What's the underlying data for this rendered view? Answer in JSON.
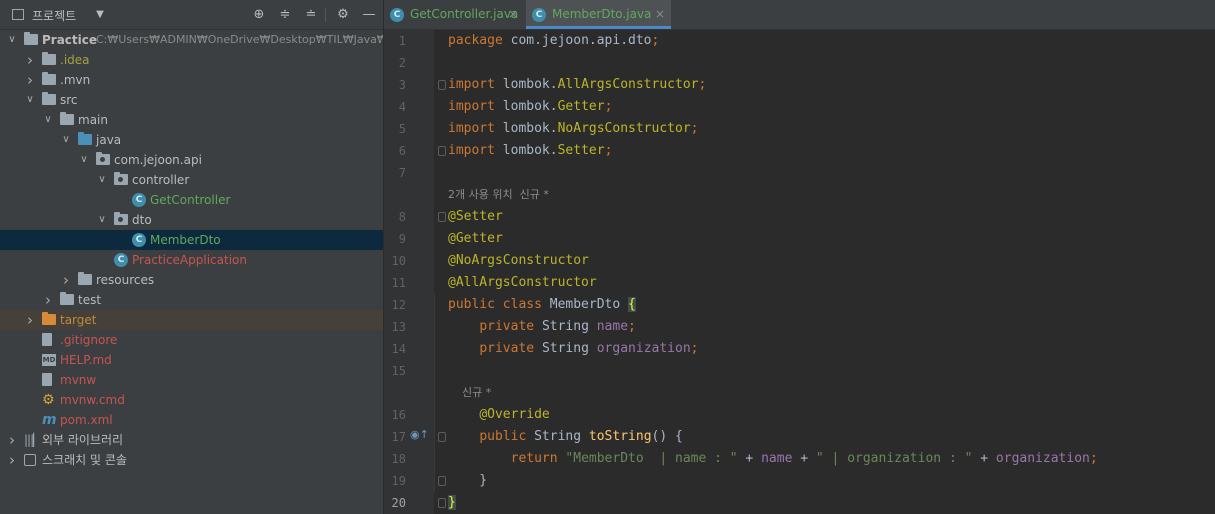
{
  "project_panel": {
    "title": "프로젝트",
    "tree": [
      {
        "label": "Practice",
        "hint": "C:₩Users₩ADMIN₩OneDrive₩Desktop₩TIL₩Java₩스프",
        "depth": 0,
        "arrow": "open",
        "icon": "module",
        "color": "white",
        "bold": true
      },
      {
        "label": ".idea",
        "depth": 1,
        "arrow": "closed",
        "icon": "folder",
        "color": "yellow"
      },
      {
        "label": ".mvn",
        "depth": 1,
        "arrow": "closed",
        "icon": "folder",
        "color": "white"
      },
      {
        "label": "src",
        "depth": 1,
        "arrow": "open",
        "icon": "folder",
        "color": "white"
      },
      {
        "label": "main",
        "depth": 2,
        "arrow": "open",
        "icon": "folder",
        "color": "white"
      },
      {
        "label": "java",
        "depth": 3,
        "arrow": "open",
        "icon": "folder-blue",
        "color": "white"
      },
      {
        "label": "com.jejoon.api",
        "depth": 4,
        "arrow": "open",
        "icon": "package",
        "color": "white"
      },
      {
        "label": "controller",
        "depth": 5,
        "arrow": "open",
        "icon": "package",
        "color": "white"
      },
      {
        "label": "GetController",
        "depth": 6,
        "arrow": "none",
        "icon": "class",
        "color": "green"
      },
      {
        "label": "dto",
        "depth": 5,
        "arrow": "open",
        "icon": "package",
        "color": "white"
      },
      {
        "label": "MemberDto",
        "depth": 6,
        "arrow": "none",
        "icon": "class",
        "color": "green",
        "selected": true
      },
      {
        "label": "PracticeApplication",
        "depth": 5,
        "arrow": "none",
        "icon": "class-app",
        "color": "red"
      },
      {
        "label": "resources",
        "depth": 3,
        "arrow": "closed",
        "icon": "folder-res",
        "color": "white"
      },
      {
        "label": "test",
        "depth": 2,
        "arrow": "closed",
        "icon": "folder",
        "color": "white"
      },
      {
        "label": "target",
        "depth": 1,
        "arrow": "closed",
        "icon": "folder-orange",
        "color": "orange",
        "highlight": true
      },
      {
        "label": ".gitignore",
        "depth": 1,
        "arrow": "none",
        "icon": "file",
        "color": "red"
      },
      {
        "label": "HELP.md",
        "depth": 1,
        "arrow": "none",
        "icon": "md",
        "color": "red"
      },
      {
        "label": "mvnw",
        "depth": 1,
        "arrow": "none",
        "icon": "file-exec",
        "color": "red"
      },
      {
        "label": "mvnw.cmd",
        "depth": 1,
        "arrow": "none",
        "icon": "cmd",
        "color": "red"
      },
      {
        "label": "pom.xml",
        "depth": 1,
        "arrow": "none",
        "icon": "maven",
        "color": "red"
      },
      {
        "label": "외부 라이브러리",
        "depth": 0,
        "arrow": "closed",
        "icon": "libraries",
        "color": "white"
      },
      {
        "label": "스크래치 및 콘솔",
        "depth": 0,
        "arrow": "closed",
        "icon": "scratches",
        "color": "white"
      }
    ]
  },
  "tabs": [
    {
      "label": "GetController.java",
      "active": false
    },
    {
      "label": "MemberDto.java",
      "active": true
    }
  ],
  "editor": {
    "current_line": 20,
    "lines": [
      {
        "n": "1",
        "tokens": [
          [
            "kw",
            "package "
          ],
          [
            "cls",
            "com.jejoon.api.dto"
          ],
          [
            "kw",
            ";"
          ]
        ]
      },
      {
        "n": "2",
        "tokens": []
      },
      {
        "n": "3",
        "tokens": [
          [
            "kw",
            "import "
          ],
          [
            "cls",
            "lombok."
          ],
          [
            "ann",
            "AllArgsConstructor"
          ],
          [
            "kw",
            ";"
          ]
        ]
      },
      {
        "n": "4",
        "tokens": [
          [
            "kw",
            "import "
          ],
          [
            "cls",
            "lombok."
          ],
          [
            "ann",
            "Getter"
          ],
          [
            "kw",
            ";"
          ]
        ]
      },
      {
        "n": "5",
        "tokens": [
          [
            "kw",
            "import "
          ],
          [
            "cls",
            "lombok."
          ],
          [
            "ann",
            "NoArgsConstructor"
          ],
          [
            "kw",
            ";"
          ]
        ]
      },
      {
        "n": "6",
        "tokens": [
          [
            "kw",
            "import "
          ],
          [
            "cls",
            "lombok."
          ],
          [
            "ann",
            "Setter"
          ],
          [
            "kw",
            ";"
          ]
        ]
      },
      {
        "n": "7",
        "tokens": []
      },
      {
        "n": "",
        "hint": "2개 사용 위치  신규 *"
      },
      {
        "n": "8",
        "tokens": [
          [
            "ann",
            "@Setter"
          ]
        ]
      },
      {
        "n": "9",
        "tokens": [
          [
            "ann",
            "@Getter"
          ]
        ]
      },
      {
        "n": "10",
        "tokens": [
          [
            "ann",
            "@NoArgsConstructor"
          ]
        ]
      },
      {
        "n": "11",
        "tokens": [
          [
            "ann",
            "@AllArgsConstructor"
          ]
        ]
      },
      {
        "n": "12",
        "tokens": [
          [
            "kw",
            "public class "
          ],
          [
            "cls",
            "MemberDto "
          ],
          [
            "brace",
            "{"
          ]
        ]
      },
      {
        "n": "13",
        "tokens": [
          [
            "cls",
            "    "
          ],
          [
            "kw",
            "private "
          ],
          [
            "cls",
            "String "
          ],
          [
            "fld",
            "name"
          ],
          [
            "kw",
            ";"
          ]
        ]
      },
      {
        "n": "14",
        "tokens": [
          [
            "cls",
            "    "
          ],
          [
            "kw",
            "private "
          ],
          [
            "cls",
            "String "
          ],
          [
            "fld",
            "organization"
          ],
          [
            "kw",
            ";"
          ]
        ]
      },
      {
        "n": "15",
        "tokens": []
      },
      {
        "n": "",
        "hint": "    신규 *"
      },
      {
        "n": "16",
        "tokens": [
          [
            "cls",
            "    "
          ],
          [
            "ann",
            "@Override"
          ]
        ]
      },
      {
        "n": "17",
        "tokens": [
          [
            "cls",
            "    "
          ],
          [
            "kw",
            "public "
          ],
          [
            "cls",
            "String "
          ],
          [
            "meth",
            "toString"
          ],
          [
            "cls",
            "() {"
          ]
        ],
        "override": true
      },
      {
        "n": "18",
        "tokens": [
          [
            "cls",
            "        "
          ],
          [
            "kw",
            "return "
          ],
          [
            "str",
            "\"MemberDto  | name : \""
          ],
          [
            "cls",
            " + "
          ],
          [
            "fld",
            "name"
          ],
          [
            "cls",
            " + "
          ],
          [
            "str",
            "\" | organization : \""
          ],
          [
            "cls",
            " + "
          ],
          [
            "fld",
            "organization"
          ],
          [
            "kw",
            ";"
          ]
        ]
      },
      {
        "n": "19",
        "tokens": [
          [
            "cls",
            "    }"
          ]
        ]
      },
      {
        "n": "20",
        "tokens": [
          [
            "brace",
            "}"
          ]
        ]
      }
    ]
  }
}
